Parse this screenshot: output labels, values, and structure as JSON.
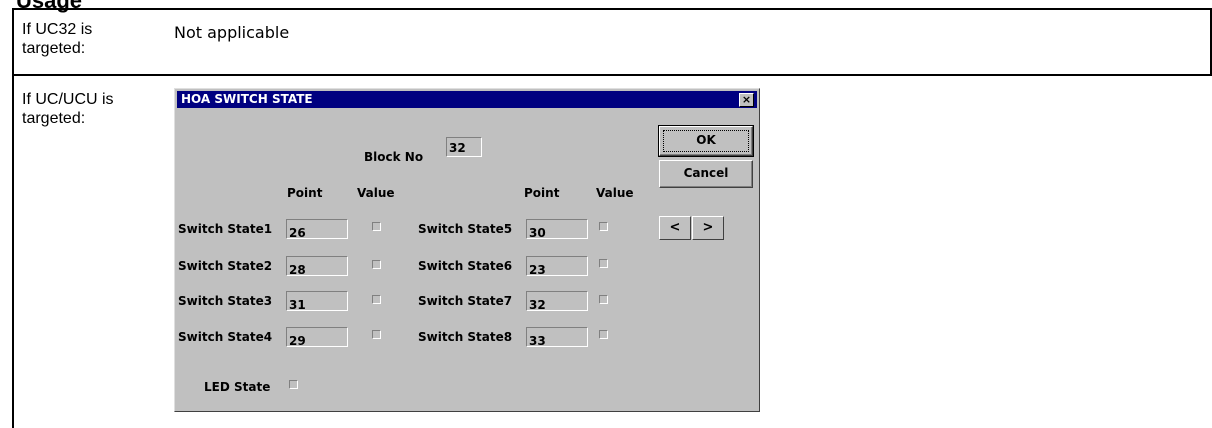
{
  "document": {
    "heading": "Usage",
    "rows": [
      {
        "label": "If UC32 is targeted:",
        "value": "Not applicable"
      },
      {
        "label": "If UC/UCU is targeted:"
      }
    ]
  },
  "dialog": {
    "title": "HOA SWITCH STATE",
    "close_glyph": "×",
    "block_label": "Block No",
    "block_value": "32",
    "ok_label": "OK",
    "cancel_label": "Cancel",
    "prev_glyph": "<",
    "next_glyph": ">",
    "col_point": "Point",
    "col_value": "Value",
    "switches_left": [
      {
        "label": "Switch State1",
        "point": "26",
        "checked": false
      },
      {
        "label": "Switch State2",
        "point": "28",
        "checked": false
      },
      {
        "label": "Switch State3",
        "point": "31",
        "checked": false
      },
      {
        "label": "Switch State4",
        "point": "29",
        "checked": false
      }
    ],
    "switches_right": [
      {
        "label": "Switch State5",
        "point": "30",
        "checked": false
      },
      {
        "label": "Switch State6",
        "point": "23",
        "checked": false
      },
      {
        "label": "Switch State7",
        "point": "32",
        "checked": false
      },
      {
        "label": "Switch State8",
        "point": "33",
        "checked": false
      }
    ],
    "led_label": "LED State",
    "led_checked": false
  },
  "colors": {
    "titlebar": "#000080",
    "dialog_face": "#c0c0c0"
  }
}
